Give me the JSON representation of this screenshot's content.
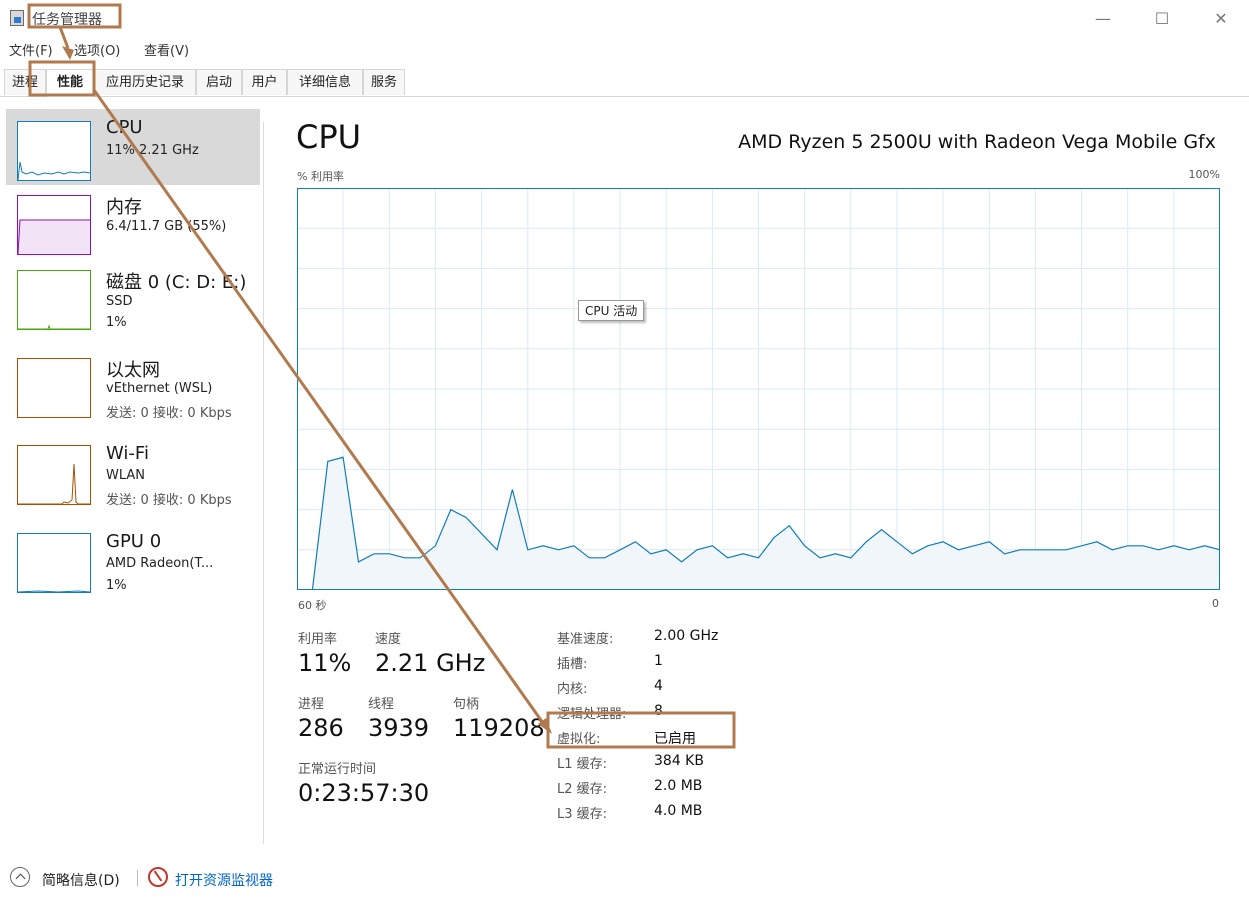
{
  "window": {
    "title": "任务管理器",
    "minimize_glyph": "—",
    "maximize_glyph": "☐",
    "close_glyph": "✕"
  },
  "menu": {
    "items": [
      "文件(F)",
      "选项(O)",
      "查看(V)"
    ]
  },
  "tabs": {
    "items": [
      "进程",
      "性能",
      "应用历史记录",
      "启动",
      "用户",
      "详细信息",
      "服务"
    ],
    "active_index": 1
  },
  "sidebar": {
    "items": [
      {
        "name": "CPU",
        "line1": "11% 2.21 GHz",
        "line2": "",
        "color": "#117dbb",
        "active": true
      },
      {
        "name": "内存",
        "line1": "6.4/11.7 GB (55%)",
        "line2": "",
        "color": "#8b12ae",
        "active": false
      },
      {
        "name": "磁盘 0 (C: D: E:)",
        "line1": "SSD",
        "line2": "1%",
        "color": "#4da60c",
        "active": false
      },
      {
        "name": "以太网",
        "line1": "vEthernet (WSL)",
        "line2": "发送: 0 接收: 0 Kbps",
        "color": "#a74f01",
        "active": false
      },
      {
        "name": "Wi-Fi",
        "line1": "WLAN",
        "line2": "发送: 0 接收: 0 Kbps",
        "color": "#a74f01",
        "active": false
      },
      {
        "name": "GPU 0",
        "line1": "AMD Radeon(T...",
        "line2": "1%",
        "color": "#117dbb",
        "active": false
      }
    ]
  },
  "main": {
    "title": "CPU",
    "model": "AMD Ryzen 5 2500U with Radeon Vega Mobile Gfx",
    "graph_label": "% 利用率",
    "graph_max": "100%",
    "x_left": "60 秒",
    "x_right": "0",
    "tooltip": "CPU 活动"
  },
  "chart_data": {
    "type": "area",
    "title": "",
    "xlabel": "",
    "ylabel": "% 利用率",
    "x_range_labels": [
      "60 秒",
      "0"
    ],
    "ylim": [
      0,
      100
    ],
    "grid": true,
    "color": "#117dbb",
    "values": [
      0,
      0,
      32,
      33,
      7,
      9,
      9,
      8,
      8,
      11,
      20,
      18,
      14,
      10,
      25,
      10,
      11,
      10,
      11,
      8,
      8,
      10,
      12,
      9,
      10,
      7,
      10,
      11,
      8,
      9,
      8,
      13,
      16,
      11,
      8,
      9,
      8,
      12,
      15,
      12,
      9,
      11,
      12,
      10,
      11,
      12,
      9,
      10,
      10,
      10,
      10,
      11,
      12,
      10,
      11,
      11,
      10,
      11,
      10,
      11,
      10
    ]
  },
  "stats": {
    "utilization_label": "利用率",
    "utilization_value": "11%",
    "speed_label": "速度",
    "speed_value": "2.21 GHz",
    "processes_label": "进程",
    "processes_value": "286",
    "threads_label": "线程",
    "threads_value": "3939",
    "handles_label": "句柄",
    "handles_value": "119208",
    "uptime_label": "正常运行时间",
    "uptime_value": "0:23:57:30"
  },
  "details": [
    {
      "label": "基准速度:",
      "value": "2.00 GHz"
    },
    {
      "label": "插槽:",
      "value": "1"
    },
    {
      "label": "内核:",
      "value": "4"
    },
    {
      "label": "逻辑处理器:",
      "value": "8"
    },
    {
      "label": "虚拟化:",
      "value": "已启用"
    },
    {
      "label": "L1 缓存:",
      "value": "384 KB"
    },
    {
      "label": "L2 缓存:",
      "value": "2.0 MB"
    },
    {
      "label": "L3 缓存:",
      "value": "4.0 MB"
    }
  ],
  "footer": {
    "summary_label": "简略信息(D)",
    "resmon_label": "打开资源监视器",
    "link_color": "#0066cc"
  },
  "annotation": {
    "color": "#b07a4e"
  }
}
